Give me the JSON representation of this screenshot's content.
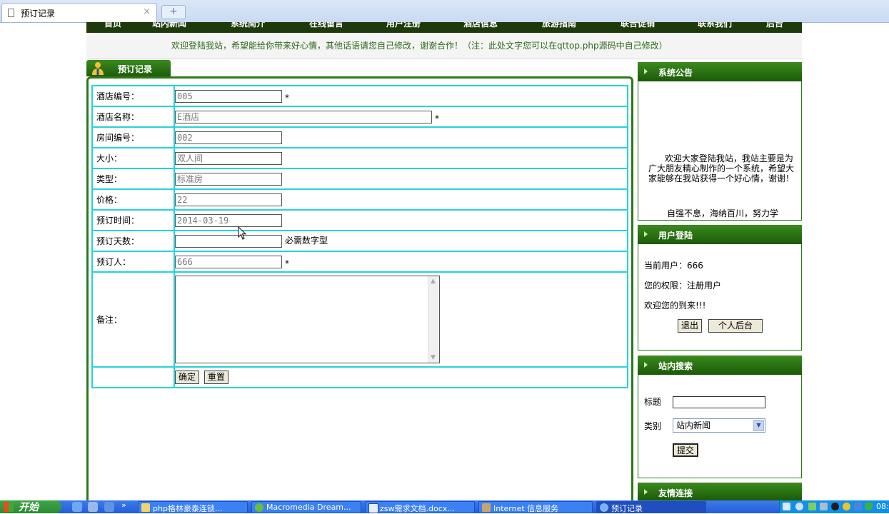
{
  "browser": {
    "tab_title": "预订记录",
    "tab_close": "×",
    "new_tab": "+"
  },
  "site": {
    "nav": [
      "首页",
      "站内新闻",
      "系统简介",
      "在线留言",
      "用户注册",
      "酒店信息",
      "旅游指南",
      "联合促销",
      "联系我们",
      "后台"
    ],
    "notice": "欢迎登陆我站，希望能给你带来好心情，其他话语请您自己修改，谢谢合作！（注：此处文字您可以在qttop.php源码中自己修改）"
  },
  "form": {
    "title": "预订记录",
    "rows": [
      {
        "label": "酒店编号：",
        "value": "005",
        "required": "*"
      },
      {
        "label": "酒店名称：",
        "value": "E酒店",
        "required": "*"
      },
      {
        "label": "房间编号：",
        "value": "002"
      },
      {
        "label": "大小：",
        "value": "双人间"
      },
      {
        "label": "类型：",
        "value": "标准房"
      },
      {
        "label": "价格：",
        "value": "22"
      },
      {
        "label": "预订时间：",
        "value": "2014-03-19"
      },
      {
        "label": "预订天数：",
        "value": "",
        "hint": "必需数字型"
      },
      {
        "label": "预订人：",
        "value": "666",
        "required": "*"
      }
    ],
    "remark_label": "备注：",
    "submit_label": "确定",
    "reset_label": "重置"
  },
  "sidebar": {
    "announcement": {
      "title": "系统公告",
      "text": "欢迎大家登陆我站，我站主要是为广大朋友精心制作的一个系统，希望大家能够在我站获得一个好心情，谢谢！",
      "scrolling_text": "自强不息，海纳百川，努力学"
    },
    "login": {
      "title": "用户登陆",
      "current_user": "当前用户：666",
      "role": "您的权限：注册用户",
      "welcome": "欢迎您的到来!!!",
      "logout_label": "退出",
      "admin_label": "个人后台"
    },
    "search": {
      "title": "站内搜索",
      "title_label": "标题",
      "category_label": "类别",
      "category_selected": "站内新闻",
      "submit_label": "提交"
    },
    "links": {
      "title": "友情连接"
    }
  },
  "taskbar": {
    "start_label": "开始",
    "tasks": [
      "php格林豪泰连锁...",
      "Macromedia Dream...",
      "zsw需求文档.docx...",
      "Internet 信息服务",
      "预订记录"
    ],
    "clock": "08:"
  },
  "colors": {
    "accent_green": "#2a7a17",
    "table_border": "#24d3d9",
    "notice_text": "#2c6a1a"
  }
}
